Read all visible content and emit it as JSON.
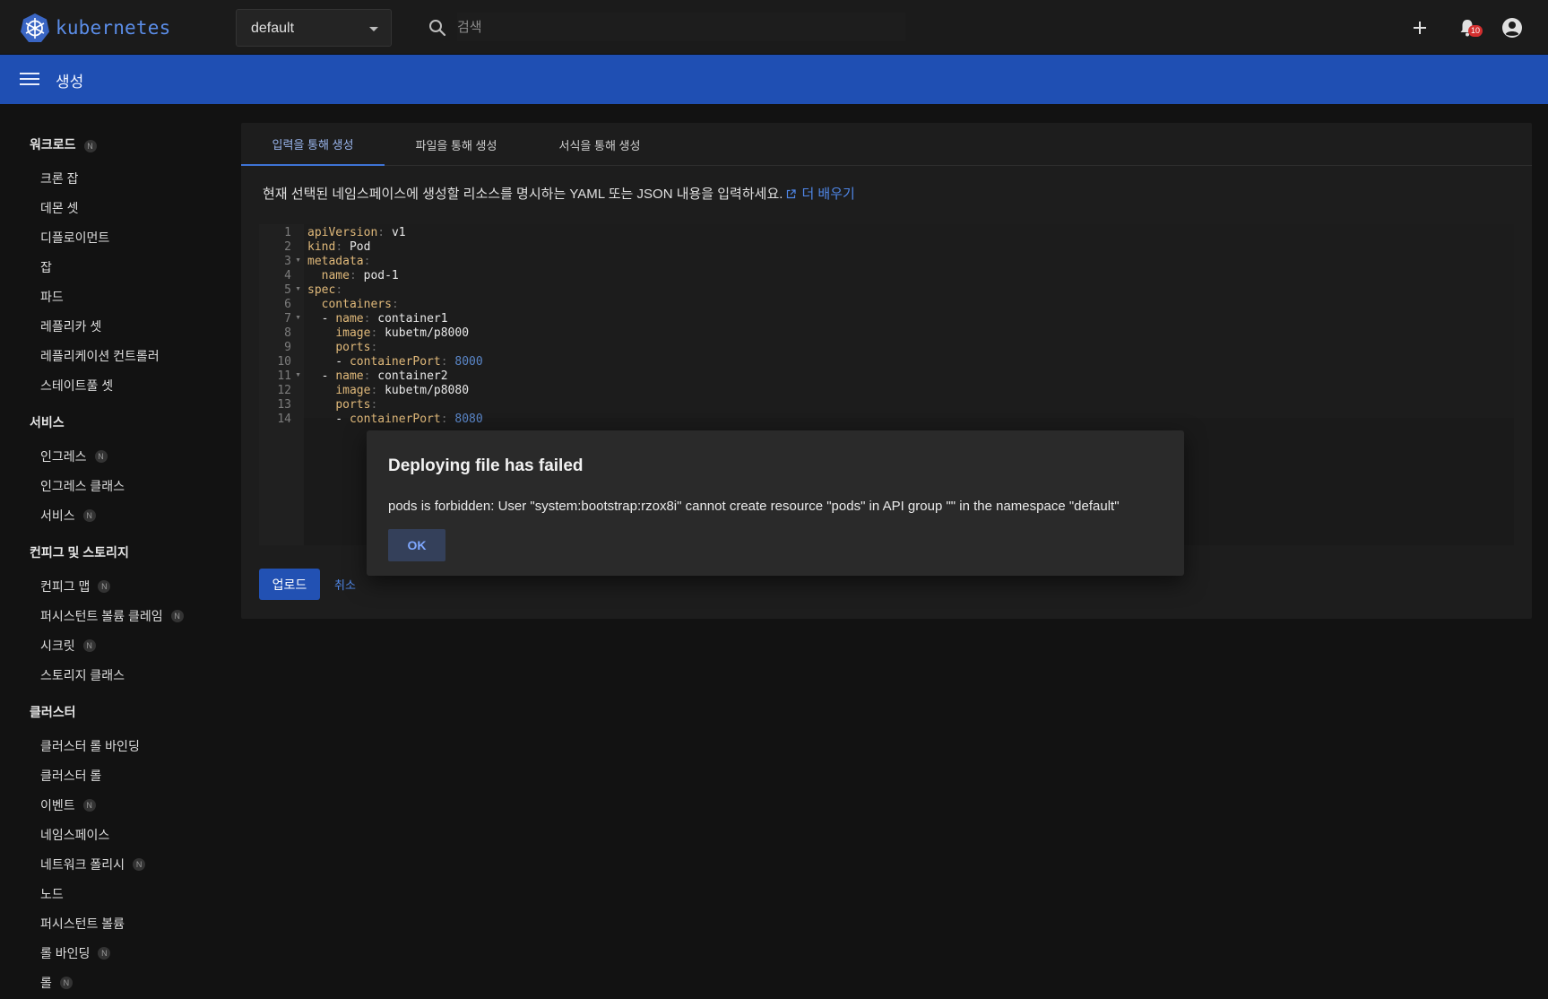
{
  "app": {
    "brand": "kubernetes"
  },
  "topbar": {
    "namespace": "default",
    "search_placeholder": "검색",
    "notification_count": "10",
    "icons": [
      "search-icon",
      "plus-icon",
      "bell-icon",
      "account-icon"
    ]
  },
  "header": {
    "title": "생성"
  },
  "sidebar": {
    "workloads": {
      "label": "워크로드",
      "badge": "N",
      "items": [
        {
          "label": "크론 잡"
        },
        {
          "label": "데몬 셋"
        },
        {
          "label": "디플로이먼트"
        },
        {
          "label": "잡"
        },
        {
          "label": "파드"
        },
        {
          "label": "레플리카 셋"
        },
        {
          "label": "레플리케이션 컨트롤러"
        },
        {
          "label": "스테이트풀 셋"
        }
      ]
    },
    "services": {
      "label": "서비스",
      "items": [
        {
          "label": "인그레스",
          "badge": "N"
        },
        {
          "label": "인그레스 클래스"
        },
        {
          "label": "서비스",
          "badge": "N"
        }
      ]
    },
    "config": {
      "label": "컨피그 및 스토리지",
      "items": [
        {
          "label": "컨피그 맵",
          "badge": "N"
        },
        {
          "label": "퍼시스턴트 볼륨 클레임",
          "badge": "N"
        },
        {
          "label": "시크릿",
          "badge": "N"
        },
        {
          "label": "스토리지 클래스"
        }
      ]
    },
    "cluster": {
      "label": "클러스터",
      "items": [
        {
          "label": "클러스터 롤 바인딩"
        },
        {
          "label": "클러스터 롤"
        },
        {
          "label": "이벤트",
          "badge": "N"
        },
        {
          "label": "네임스페이스"
        },
        {
          "label": "네트워크 폴리시",
          "badge": "N"
        },
        {
          "label": "노드"
        },
        {
          "label": "퍼시스턴트 볼륨"
        },
        {
          "label": "롤 바인딩",
          "badge": "N"
        },
        {
          "label": "롤",
          "badge": "N"
        }
      ]
    }
  },
  "main": {
    "tabs": [
      {
        "label": "입력을 통해 생성",
        "active": true
      },
      {
        "label": "파일을 통해 생성"
      },
      {
        "label": "서식을 통해 생성"
      }
    ],
    "description": "현재 선택된 네임스페이스에 생성할 리소스를 명시하는 YAML 또는 JSON 내용을 입력하세요.",
    "learn_more": "더 배우기",
    "code": [
      "apiVersion: v1",
      "kind: Pod",
      "metadata:",
      "  name: pod-1",
      "spec:",
      "  containers:",
      "  - name: container1",
      "    image: kubetm/p8000",
      "    ports:",
      "    - containerPort: 8000",
      "  - name: container2",
      "    image: kubetm/p8080",
      "    ports:",
      "    - containerPort: 8080"
    ],
    "upload_label": "업로드",
    "cancel_label": "취소"
  },
  "dialog": {
    "title": "Deploying file has failed",
    "message": "pods is forbidden: User \"system:bootstrap:rzox8i\" cannot create resource \"pods\" in API group \"\" in the namespace \"default\"",
    "ok_label": "OK"
  },
  "colors": {
    "accent": "#1f4fb3",
    "badge": "#d32f2f",
    "link": "#4f86e6"
  }
}
